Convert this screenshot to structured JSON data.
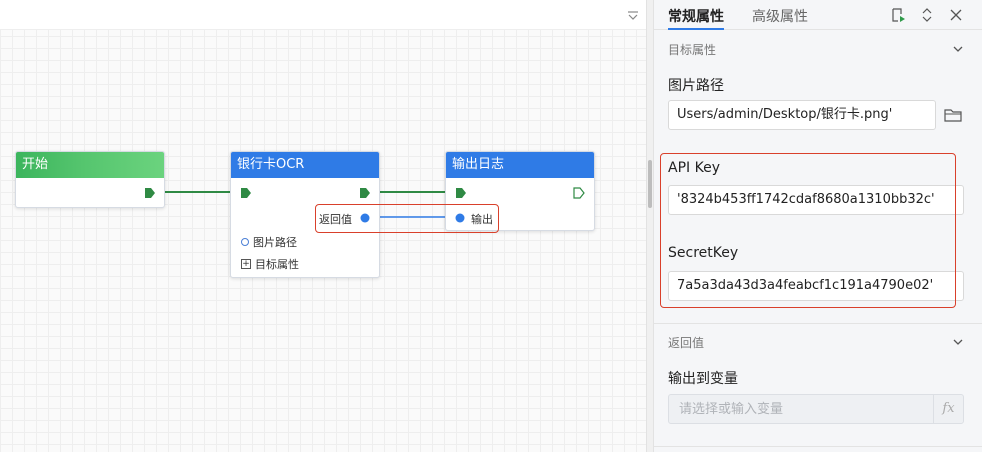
{
  "nodes": {
    "start": {
      "title": "开始"
    },
    "ocr": {
      "title": "银行卡OCR",
      "params": [
        "图片路径",
        "目标属性"
      ],
      "output_label": "返回值"
    },
    "log": {
      "title": "输出日志",
      "input_label": "输出"
    }
  },
  "panel": {
    "tabs": [
      "常规属性",
      "高级属性"
    ],
    "sections": {
      "target": {
        "title": "目标属性",
        "image_path_label": "图片路径",
        "image_path_value": "Users/admin/Desktop/银行卡.png'",
        "api_key_label": "API Key",
        "api_key_value": "'8324b453ff1742cdaf8680a1310bb32c'",
        "secret_key_label": "SecretKey",
        "secret_key_value": "7a5a3da43d3a4feabcf1c191a4790e02'"
      },
      "return": {
        "title": "返回值",
        "output_var_label": "输出到变量",
        "output_var_placeholder": "请选择或输入变量",
        "fx_label": "fx"
      }
    }
  },
  "icons": {
    "collapse": "chevron-down-icon",
    "run": "run-icon",
    "expand": "expand-collapse-icon",
    "close": "close-icon",
    "folder": "folder-icon"
  },
  "colors": {
    "accent": "#2f7be6",
    "start_green": "#4cc064",
    "connector_green": "#2f8a44",
    "connector_blue": "#2f7be6",
    "highlight_red": "#d9402b"
  }
}
